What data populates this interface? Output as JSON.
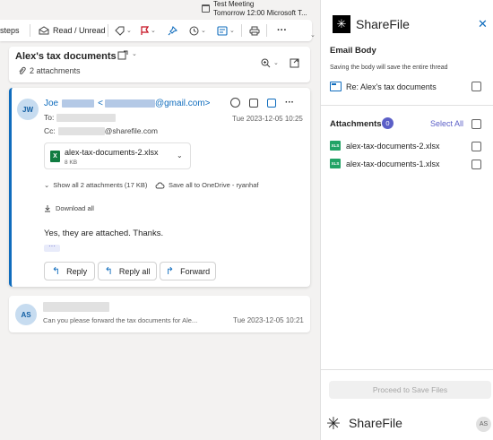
{
  "meeting": {
    "title": "Test Meeting",
    "time": "Tomorrow 12:00 Microsoft T..."
  },
  "toolbar": {
    "steps_label": "steps",
    "read_unread_label": "Read / Unread"
  },
  "thread": {
    "subject": "Alex's tax documents",
    "attachments_count_label": "2 attachments"
  },
  "message": {
    "avatar_initials": "JW",
    "sender_first": "Joe",
    "sender_email_prefix": "<",
    "sender_email_suffix": "@gmail.com>",
    "to_label": "To:",
    "cc_label": "Cc:",
    "cc_domain": "@sharefile.com",
    "date": "Tue 2023-12-05 10:25",
    "attachment": {
      "name": "alex-tax-documents-2.xlsx",
      "size": "8 KB",
      "icon_text": "X"
    },
    "show_all_label": "Show all 2 attachments (17 KB)",
    "save_onedrive_label": "Save all to OneDrive - ryanhaf",
    "download_all_label": "Download all",
    "body": "Yes, they are attached. Thanks.",
    "more_label": "···",
    "reply_label": "Reply",
    "reply_all_label": "Reply all",
    "forward_label": "Forward"
  },
  "message2": {
    "avatar_initials": "AS",
    "preview": "Can you please forward the tax documents for Ale...",
    "date": "Tue 2023-12-05 10:21"
  },
  "sharefile": {
    "title": "ShareFile",
    "email_body_heading": "Email Body",
    "email_body_sub": "Saving the body will save the entire thread",
    "email_item": "Re: Alex's tax documents",
    "attachments_heading": "Attachments",
    "attachments_count": "0",
    "select_all_label": "Select All",
    "files": [
      {
        "name": "alex-tax-documents-2.xlsx",
        "icon_text": "XLS"
      },
      {
        "name": "alex-tax-documents-1.xlsx",
        "icon_text": "XLS"
      }
    ],
    "proceed_label": "Proceed to Save Files",
    "footer_brand": "ShareFile",
    "user_initials": "AS"
  },
  "colors": {
    "accent": "#0f6cbd",
    "sharefile_purple": "#5b5fc7",
    "excel_green": "#107c41"
  }
}
